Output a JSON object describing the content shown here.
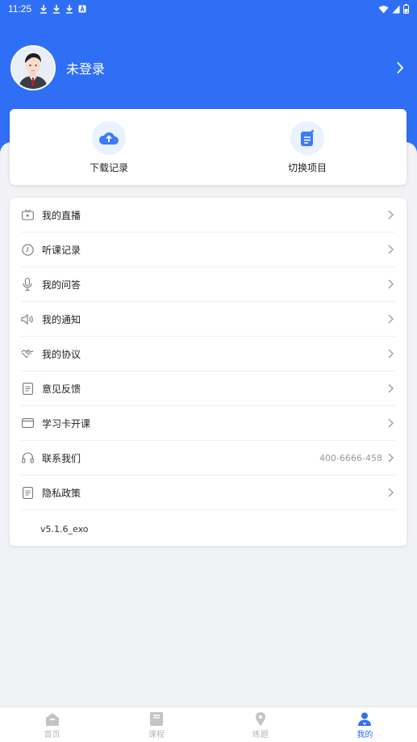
{
  "status_bar": {
    "time": "11:25",
    "left_icons": [
      "download-icon",
      "download-icon",
      "download-icon",
      "a-icon"
    ],
    "right_icons": [
      "wifi-icon",
      "signal-icon",
      "battery-icon"
    ]
  },
  "profile": {
    "name": "未登录"
  },
  "quick_actions": [
    {
      "label": "下载记录",
      "icon": "cloud-upload-icon"
    },
    {
      "label": "切换项目",
      "icon": "switch-project-icon"
    }
  ],
  "menu": [
    {
      "label": "我的直播",
      "icon": "live-tv-icon"
    },
    {
      "label": "听课记录",
      "icon": "clock-icon"
    },
    {
      "label": "我的问答",
      "icon": "microphone-icon"
    },
    {
      "label": "我的通知",
      "icon": "speaker-icon"
    },
    {
      "label": "我的协议",
      "icon": "handshake-icon"
    },
    {
      "label": "意见反馈",
      "icon": "document-icon"
    },
    {
      "label": "学习卡开课",
      "icon": "card-icon"
    },
    {
      "label": "联系我们",
      "icon": "headphones-icon",
      "extra": "400-6666-458"
    },
    {
      "label": "隐私政策",
      "icon": "document-icon"
    }
  ],
  "version": "v5.1.6_exo",
  "tabs": [
    {
      "label": "首页",
      "icon": "home-icon",
      "active": false
    },
    {
      "label": "课程",
      "icon": "course-icon",
      "active": false
    },
    {
      "label": "练题",
      "icon": "practice-icon",
      "active": false
    },
    {
      "label": "我的",
      "icon": "profile-icon",
      "active": true
    }
  ],
  "colors": {
    "primary": "#2f6ff5",
    "background": "#f1f2f5",
    "inactive_tab": "#b6b6b6"
  }
}
